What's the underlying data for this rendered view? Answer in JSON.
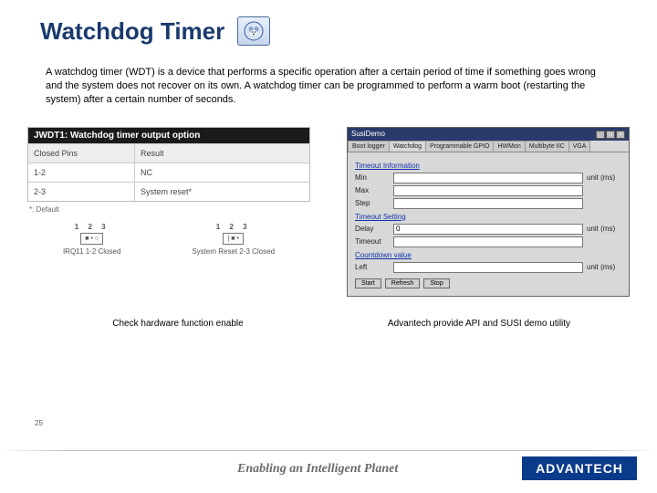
{
  "title": "Watchdog Timer",
  "intro": "A watchdog timer (WDT) is a device that performs a specific operation after a certain period of time if something goes wrong and the system does not recover on its own. A watchdog timer can be programmed to perform a warm boot (restarting the system) after a certain number of seconds.",
  "jumper_table": {
    "header": "JWDT1: Watchdog timer output option",
    "cols": [
      "Closed Pins",
      "Result"
    ],
    "rows": [
      {
        "pins": "1-2",
        "result": "NC"
      },
      {
        "pins": "2-3",
        "result": "System reset*"
      }
    ],
    "note": "*: Default",
    "pin_groups": [
      {
        "nums": "1  2  3",
        "box": "■  •  ○",
        "label": "IRQ11 1-2 Closed"
      },
      {
        "nums": "1  2  3",
        "box": "|  ■  •",
        "label": "System Reset 2-3 Closed"
      }
    ]
  },
  "app": {
    "titlebar": "SusiDemo",
    "tabs": [
      "Boot logger",
      "Watchdog",
      "Programmable GPIO",
      "HWMon",
      "Multibyte IIC",
      "VGA"
    ],
    "active_tab": 1,
    "sections": {
      "timeout_info": {
        "title": "Timeout Information",
        "rows": [
          {
            "label": "Min",
            "unit": "unit (ms)"
          },
          {
            "label": "Max",
            "unit": ""
          },
          {
            "label": "Step",
            "unit": ""
          }
        ]
      },
      "timeout_setting": {
        "title": "Timeout Setting",
        "rows": [
          {
            "label": "Delay",
            "value": "0",
            "unit": "unit (ms)"
          },
          {
            "label": "Timeout",
            "value": "",
            "unit": ""
          }
        ]
      },
      "countdown": {
        "title": "Countdown value",
        "rows": [
          {
            "label": "Left",
            "unit": "unit (ms)"
          }
        ]
      }
    },
    "buttons": [
      "Start",
      "Refresh",
      "Stop"
    ]
  },
  "captions": {
    "left": "Check hardware function enable",
    "right": "Advantech provide API and SUSI demo utility"
  },
  "page_number": "25",
  "tagline": "Enabling an Intelligent Planet",
  "brand": "ADVANTECH"
}
